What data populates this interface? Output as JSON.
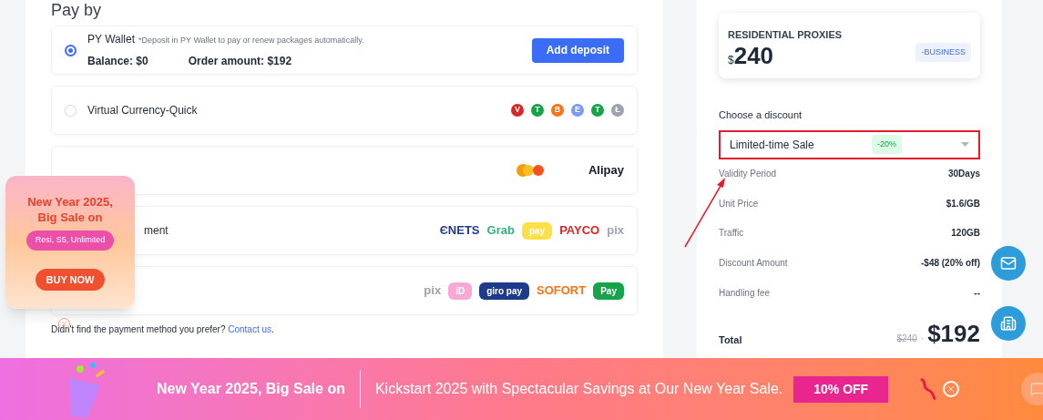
{
  "heading": "Pay by",
  "methods": [
    {
      "label": "PY Wallet",
      "note": "*Deposit in PY Wallet to pay or renew packages automatically.",
      "balance": "Balance: $0",
      "order": "Order amount: $192",
      "button": "Add deposit",
      "selected": true
    },
    {
      "label": "Virtual Currency-Quick",
      "selected": false,
      "logos": [
        {
          "kind": "coin",
          "text": "V",
          "color": "#dc2626"
        },
        {
          "kind": "coin",
          "text": "T",
          "color": "#16a34a"
        },
        {
          "kind": "coin",
          "text": "B",
          "color": "#f97316"
        },
        {
          "kind": "coin",
          "text": "E",
          "color": "#7c9cf0"
        },
        {
          "kind": "coin",
          "text": "T",
          "color": "#16a34a"
        },
        {
          "kind": "coin",
          "text": "Ł",
          "color": "#9ca3af"
        }
      ]
    },
    {
      "logos": [
        {
          "kind": "dots"
        },
        {
          "kind": "word",
          "text": "Alipay",
          "color": "#111827"
        }
      ]
    },
    {
      "label": "ment",
      "logos": [
        {
          "kind": "word",
          "text": "ЄNETS",
          "color": "#1e3a8a"
        },
        {
          "kind": "word",
          "text": "Grab",
          "color": "#34b27b"
        },
        {
          "kind": "pill",
          "text": "pay",
          "color": "#fde047"
        },
        {
          "kind": "word",
          "text": "PAYCO",
          "color": "#dc2626"
        },
        {
          "kind": "word",
          "text": "pix",
          "color": "#9ca3af"
        }
      ]
    },
    {
      "logos": [
        {
          "kind": "word",
          "text": "pix",
          "color": "#9ca3af"
        },
        {
          "kind": "pill",
          "text": "iD",
          "color": "#f9a8d4"
        },
        {
          "kind": "pill",
          "text": "giro pay",
          "color": "#1e3a8a"
        },
        {
          "kind": "word",
          "text": "SOFORT",
          "color": "#f97316"
        },
        {
          "kind": "pill",
          "text": "Pay",
          "color": "#16a34a"
        }
      ]
    }
  ],
  "help": {
    "text": "Didn't find the payment method you prefer?",
    "link": "Contact us",
    "end": "."
  },
  "promo": {
    "title": "New Year 2025, Big Sale on",
    "tag": "Resi, S5, Unlimited",
    "button": "BUY NOW"
  },
  "product": {
    "name": "RESIDENTIAL PROXIES",
    "currency": "$",
    "price": "240",
    "badge": "-BUSINESS"
  },
  "discount": {
    "label": "Choose a discount",
    "value": "Limited-time Sale",
    "badge": "-20%"
  },
  "details": [
    {
      "label": "Validity Period",
      "value": "30Days"
    },
    {
      "label": "Unit Price",
      "value": "$1.6/GB"
    },
    {
      "label": "Traffic",
      "value": "120GB"
    },
    {
      "label": "Discount Amount",
      "value": "-$48 (20% off)"
    },
    {
      "label": "Handling fee",
      "value": "--"
    }
  ],
  "total": {
    "label": "Total",
    "old": "$240",
    "sep": "·",
    "price": "$192"
  },
  "banner": {
    "title": "New Year 2025, Big Sale on",
    "text": "Kickstart 2025 with Spectacular Savings at Our New Year Sale.",
    "badge": "10% OFF"
  }
}
